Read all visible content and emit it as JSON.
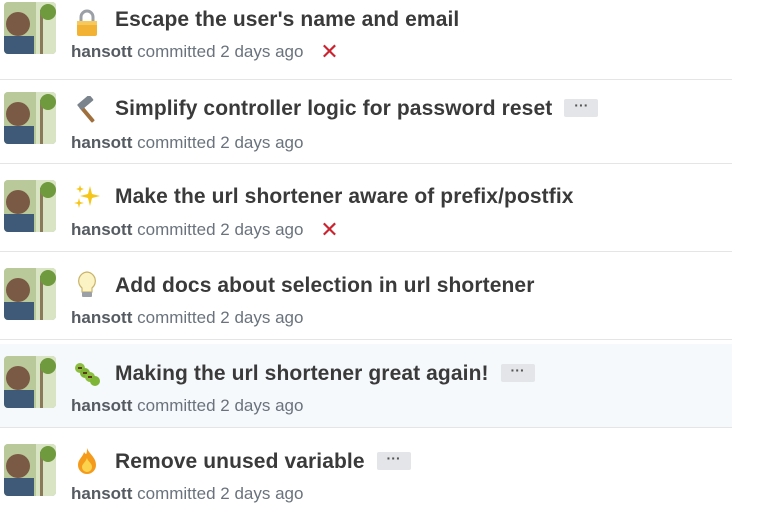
{
  "commits": [
    {
      "emoji": "lock-icon",
      "title": "Escape the user's name and email",
      "has_ellipsis": false,
      "author": "hansott",
      "verb": "committed",
      "time": "2 days ago",
      "status": "failed",
      "status_symbol": "✕",
      "highlighted": false
    },
    {
      "emoji": "hammer-icon",
      "title": "Simplify controller logic for password reset",
      "has_ellipsis": true,
      "ellipsis_label": "···",
      "author": "hansott",
      "verb": "committed",
      "time": "2 days ago",
      "status": "none",
      "highlighted": false
    },
    {
      "emoji": "sparkles-icon",
      "title": "Make the url shortener aware of prefix/postfix",
      "has_ellipsis": false,
      "author": "hansott",
      "verb": "committed",
      "time": "2 days ago",
      "status": "failed",
      "status_symbol": "✕",
      "highlighted": false
    },
    {
      "emoji": "lightbulb-icon",
      "title": "Add docs about selection in url shortener",
      "has_ellipsis": false,
      "author": "hansott",
      "verb": "committed",
      "time": "2 days ago",
      "status": "none",
      "highlighted": false
    },
    {
      "emoji": "caterpillar-icon",
      "title": "Making the url shortener great again!",
      "has_ellipsis": true,
      "ellipsis_label": "···",
      "author": "hansott",
      "verb": "committed",
      "time": "2 days ago",
      "status": "none",
      "highlighted": true
    },
    {
      "emoji": "fire-icon",
      "title": "Remove unused variable",
      "has_ellipsis": true,
      "ellipsis_label": "···",
      "author": "hansott",
      "verb": "committed",
      "time": "2 days ago",
      "status": "none",
      "highlighted": false
    }
  ],
  "colors": {
    "failed": "#cb2431",
    "highlight_row": "#f6f9fc",
    "divider": "#e5e5e5"
  }
}
